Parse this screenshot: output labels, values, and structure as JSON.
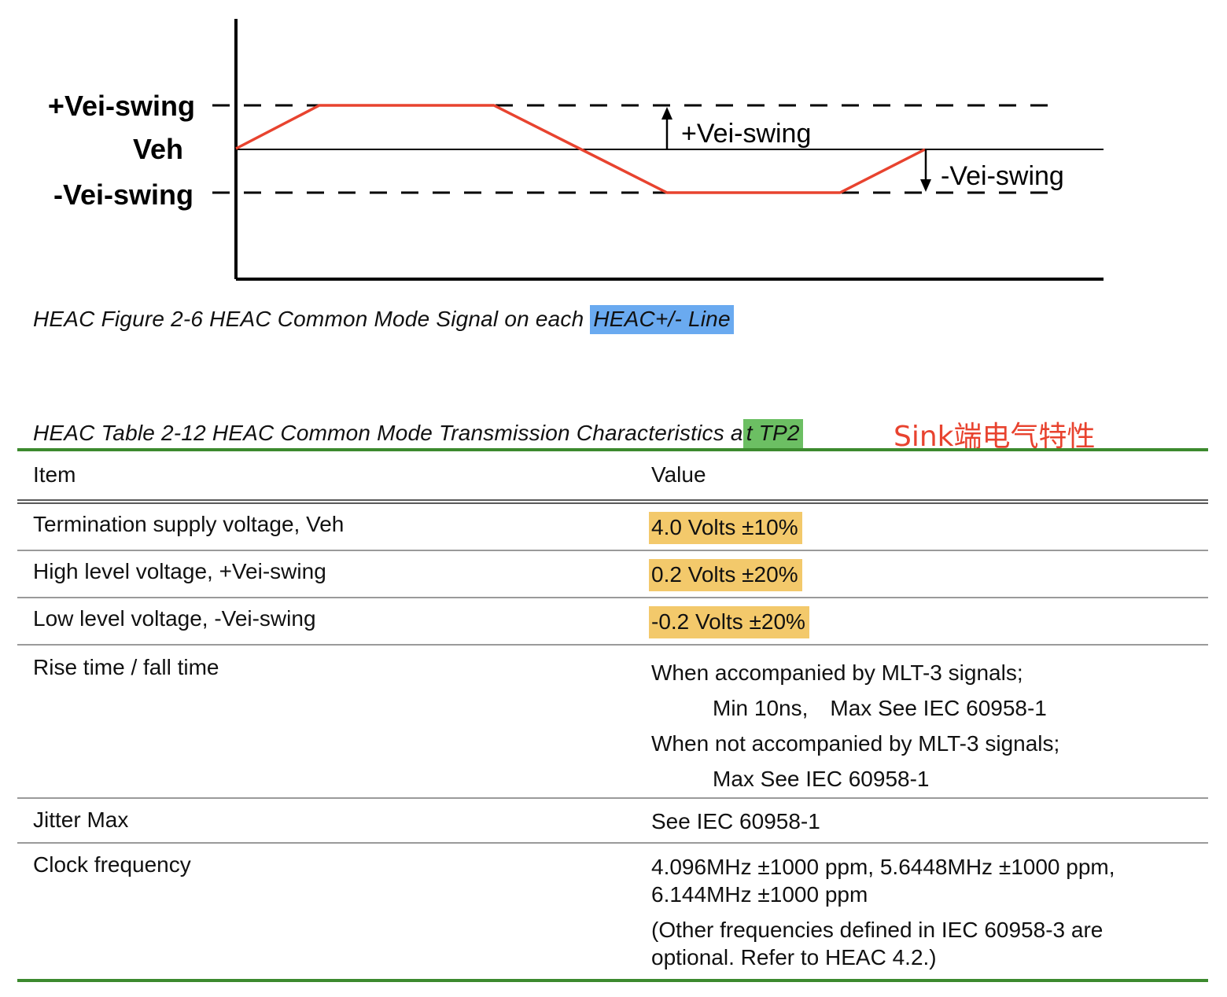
{
  "figure": {
    "labels": {
      "plus_swing": "+Vei-swing",
      "veh": "Veh",
      "minus_swing": "-Vei-swing"
    },
    "annotations": {
      "plus_swing": "+Vei-swing",
      "minus_swing": "-Vei-swing"
    },
    "caption_prefix": "HEAC Figure 2-6 HEAC Common Mode Signal on each ",
    "caption_highlight": "HEAC+/- Line",
    "colors": {
      "signal": "#e8432f",
      "highlight": "#6aaaf0"
    }
  },
  "table": {
    "caption_prefix": "HEAC Table 2-12 HEAC Common Mode Transmission Characteristics a",
    "caption_highlight": "t TP2",
    "note": "Sink端电气特性",
    "header": {
      "item": "Item",
      "value": "Value"
    },
    "rows": [
      {
        "item": "Termination supply voltage, Veh",
        "value": "4.0 Volts ±10%"
      },
      {
        "item": "High level voltage, +Vei-swing",
        "value": "0.2 Volts ±20%"
      },
      {
        "item": "Low level voltage, -Vei-swing",
        "value": "-0.2 Volts ±20%"
      },
      {
        "item": "Rise time / fall time",
        "value_lines": [
          "When accompanied by MLT-3 signals;",
          "Min 10ns, Max See IEC 60958-1",
          "When not accompanied by MLT-3 signals;",
          "Max See IEC 60958-1"
        ]
      },
      {
        "item": "Jitter Max",
        "value": "See IEC 60958-1"
      },
      {
        "item": "Clock frequency",
        "value_lines": [
          "4.096MHz ±1000 ppm, 5.6448MHz ±1000 ppm,",
          "6.144MHz ±1000 ppm",
          "(Other frequencies defined in IEC 60958-3 are",
          "optional. Refer to HEAC 4.2.)"
        ]
      }
    ],
    "colors": {
      "rule": "#3c8a2e",
      "value_highlight": "#f3c96b",
      "caption_highlight": "#6cbf63",
      "note": "#e8432f"
    }
  }
}
